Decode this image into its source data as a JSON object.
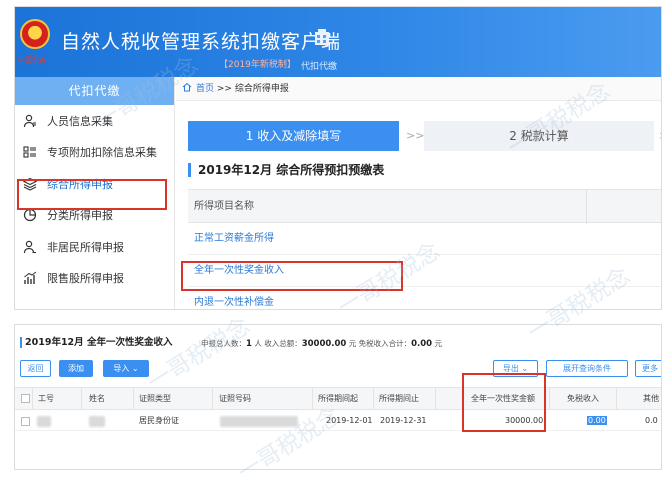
{
  "header": {
    "emblem_text": "中国税务",
    "app_title": "自然人税收管理系统扣缴客户端",
    "version": "【2019年新税制】",
    "subtitle": "代扣代缴"
  },
  "sidebar": {
    "title": "代扣代缴",
    "items": [
      {
        "label": "人员信息采集",
        "icon": "person-card-icon"
      },
      {
        "label": "专项附加扣除信息采集",
        "icon": "list-icon"
      },
      {
        "label": "综合所得申报",
        "icon": "layers-icon"
      },
      {
        "label": "分类所得申报",
        "icon": "pie-icon"
      },
      {
        "label": "非居民所得申报",
        "icon": "person-icon"
      },
      {
        "label": "限售股所得申报",
        "icon": "bar-chart-icon"
      }
    ]
  },
  "breadcrumb": {
    "home": "首页",
    "separator": ">>",
    "current": "综合所得申报"
  },
  "steps": {
    "step1": "1 收入及减除填写",
    "step2": "2 税款计算",
    "arrow": ">>"
  },
  "form": {
    "title": "2019年12月  综合所得预扣预缴表",
    "column_header": "所得项目名称",
    "rows": [
      "正常工资薪金所得",
      "全年一次性奖金收入",
      "内退一次性补偿金"
    ]
  },
  "panel": {
    "title": "2019年12月 全年一次性奖金收入",
    "stats_label1": "申报总人数：",
    "stats_value1": "1",
    "stats_unit1": "人",
    "stats_label2": "收入总额：",
    "stats_value2": "30000.00",
    "stats_unit2": "元",
    "stats_label3": "免税收入合计：",
    "stats_value3": "0.00",
    "stats_unit3": "元",
    "buttons": {
      "back": "返回",
      "add": "添加",
      "import": "导入",
      "export": "导出",
      "expand": "展开查询条件",
      "more": "更多"
    },
    "columns": [
      "工号",
      "姓名",
      "证照类型",
      "证照号码",
      "所得期间起",
      "所得期间止",
      "全年一次性奖金额",
      "免税收入",
      "其他"
    ],
    "row": {
      "id_type": "居民身份证",
      "period_start": "2019-12-01",
      "period_end": "2019-12-31",
      "bonus_amount": "30000.00",
      "tax_free": "0.00",
      "other": "0.0"
    }
  },
  "watermark": "一哥税税念",
  "colors": {
    "header_blue": "#1c73d8",
    "accent_blue": "#3b8ff0",
    "highlight_red": "#d9332a",
    "sidebar_head": "#6fb0f3"
  }
}
